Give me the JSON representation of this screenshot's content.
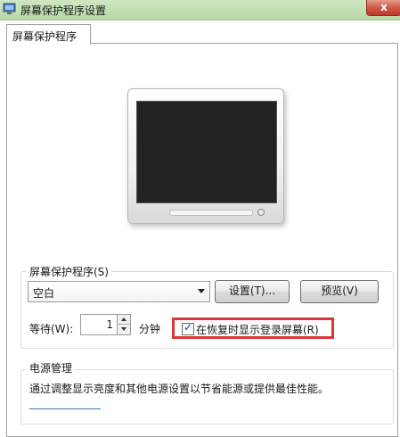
{
  "window": {
    "title": "屏幕保护程序设置",
    "close_glyph": "x"
  },
  "tabs": [
    {
      "label": "屏幕保护程序",
      "active": true
    }
  ],
  "screensaver": {
    "group_label": "屏幕保护程序(S)",
    "selected": "空白",
    "settings_button": "设置(T)...",
    "preview_button": "预览(V)",
    "wait_label": "等待(W):",
    "wait_value": "1",
    "wait_unit": "分钟",
    "resume_checkbox_label": "在恢复时显示登录屏幕(R)",
    "resume_checked": true,
    "check_glyph": "✓"
  },
  "power": {
    "group_label": "电源管理",
    "description": "通过调整显示亮度和其他电源设置以节省能源或提供最佳性能。"
  },
  "colors": {
    "titlebar": "#c2e0b4",
    "highlight": "#d93838",
    "preview_screen": "#222222",
    "close_button": "#c23a2a"
  },
  "icons": {
    "app": "screensaver-app-icon",
    "close": "close-icon",
    "dropdown": "chevron-down-icon",
    "spin_up": "spin-up-icon",
    "spin_down": "spin-down-icon",
    "check": "checkmark-icon"
  }
}
